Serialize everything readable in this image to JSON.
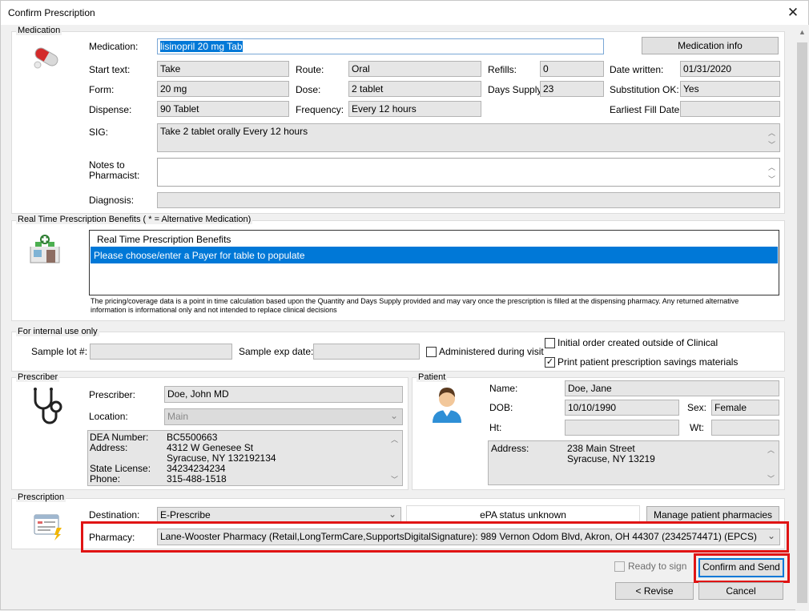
{
  "window": {
    "title": "Confirm Prescription",
    "close": "✕"
  },
  "medication": {
    "group_label": "Medication",
    "medication_label": "Medication:",
    "medication_value": "lisinopril 20 mg Tab",
    "info_button": "Medication info",
    "start_text_label": "Start text:",
    "start_text": "Take",
    "route_label": "Route:",
    "route": "Oral",
    "refills_label": "Refills:",
    "refills": "0",
    "date_written_label": "Date written:",
    "date_written": "01/31/2020",
    "form_label": "Form:",
    "form": "20 mg",
    "dose_label": "Dose:",
    "dose": "2 tablet",
    "days_supply_label": "Days Supply:",
    "days_supply": "23",
    "substitution_label": "Substitution OK:",
    "substitution": "Yes",
    "dispense_label": "Dispense:",
    "dispense": "90 Tablet",
    "frequency_label": "Frequency:",
    "frequency": "Every 12 hours",
    "earliest_fill_label": "Earliest Fill Date:",
    "earliest_fill": "",
    "sig_label": "SIG:",
    "sig": "Take 2 tablet orally Every 12 hours",
    "notes_label_1": "Notes to",
    "notes_label_2": "Pharmacist:",
    "notes": "",
    "diagnosis_label": "Diagnosis:",
    "diagnosis": ""
  },
  "rtpb": {
    "group_label": "Real Time Prescription Benefits ( * = Alternative Medication)",
    "header": "Real Time Prescription Benefits",
    "row": "Please choose/enter a Payer for table to populate",
    "disclaimer": "The pricing/coverage data is a point in time calculation based upon the Quantity and Days Supply provided and may vary once the prescription is filled at the dispensing pharmacy. Any returned alternative information is informational only and not intended to replace clinical decisions"
  },
  "internal": {
    "group_label": "For internal use only",
    "sample_lot_label": "Sample lot #:",
    "sample_lot": "",
    "sample_exp_label": "Sample exp date:",
    "sample_exp": "",
    "administered_label": "Administered during visit",
    "administered_checked": false,
    "initial_order_label": "Initial order created outside of Clinical",
    "initial_order_checked": false,
    "print_savings_label": "Print patient prescription savings materials",
    "print_savings_checked": true
  },
  "prescriber": {
    "group_label": "Prescriber",
    "prescriber_label": "Prescriber:",
    "prescriber": "Doe, John MD",
    "location_label": "Location:",
    "location": "Main",
    "details": [
      {
        "label": "DEA Number:",
        "value": "BC5500663"
      },
      {
        "label": "Address:",
        "value": "4312 W Genesee St"
      },
      {
        "label": "",
        "value": "Syracuse, NY 132192134"
      },
      {
        "label": "State License:",
        "value": "34234234234"
      },
      {
        "label": "Phone:",
        "value": "315-488-1518"
      }
    ]
  },
  "patient": {
    "group_label": "Patient",
    "name_label": "Name:",
    "name": "Doe, Jane",
    "dob_label": "DOB:",
    "dob": "10/10/1990",
    "sex_label": "Sex:",
    "sex": "Female",
    "ht_label": "Ht:",
    "ht": "",
    "wt_label": "Wt:",
    "wt": "",
    "address_label": "Address:",
    "address_1": "238 Main Street",
    "address_2": "Syracuse, NY 13219"
  },
  "prescription": {
    "group_label": "Prescription",
    "destination_label": "Destination:",
    "destination": "E-Prescribe",
    "epa_status": "ePA status unknown",
    "manage_pharmacies": "Manage patient pharmacies",
    "pharmacy_label": "Pharmacy:",
    "pharmacy": "Lane-Wooster Pharmacy (Retail,LongTermCare,SupportsDigitalSignature):  989 Vernon Odom Blvd, Akron, OH 44307 (2342574471) (EPCS)"
  },
  "footer": {
    "ready_to_sign": "Ready to sign",
    "ready_checked": false,
    "confirm_send": "Confirm and Send",
    "revise": "< Revise",
    "cancel": "Cancel"
  },
  "colors": {
    "highlight": "#e01414",
    "selection": "#0078d7"
  }
}
